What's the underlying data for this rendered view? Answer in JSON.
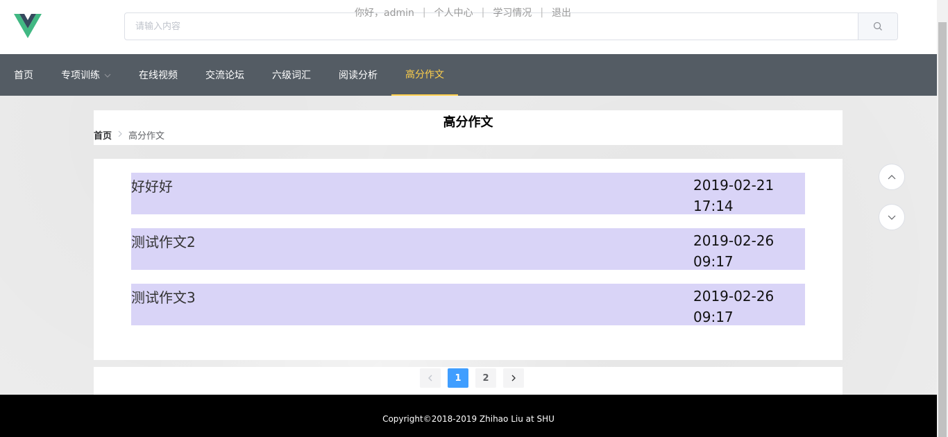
{
  "header": {
    "search_placeholder": "请输入内容",
    "user_links": {
      "greeting": "你好，admin",
      "separator": "|",
      "profile": "个人中心",
      "study": "学习情况",
      "logout": "退出"
    },
    "logo_icon": "vue-logo-icon",
    "search_icon": "search-icon"
  },
  "nav": {
    "items": [
      {
        "label": "首页"
      },
      {
        "label": "专项训练",
        "has_dropdown": true
      },
      {
        "label": "在线视频"
      },
      {
        "label": "交流论坛"
      },
      {
        "label": "六级词汇"
      },
      {
        "label": "阅读分析"
      },
      {
        "label": "高分作文",
        "active": true
      }
    ]
  },
  "page": {
    "title": "高分作文",
    "breadcrumb": {
      "home": "首页",
      "current": "高分作文"
    }
  },
  "essays": [
    {
      "title": "好好好",
      "date": "2019-02-21 17:14"
    },
    {
      "title": "测试作文2",
      "date": "2019-02-26 09:17"
    },
    {
      "title": "测试作文3",
      "date": "2019-02-26 09:17"
    }
  ],
  "pagination": {
    "pages": [
      "1",
      "2"
    ],
    "current": "1"
  },
  "footer": {
    "copyright": "Copyright©2018-2019 Zhihao Liu at SHU"
  },
  "colors": {
    "nav_bg": "#545c64",
    "nav_active": "#ffd04b",
    "row_bg": "#d9d4f7",
    "page_active": "#409eff",
    "footer_bg": "#000000"
  }
}
